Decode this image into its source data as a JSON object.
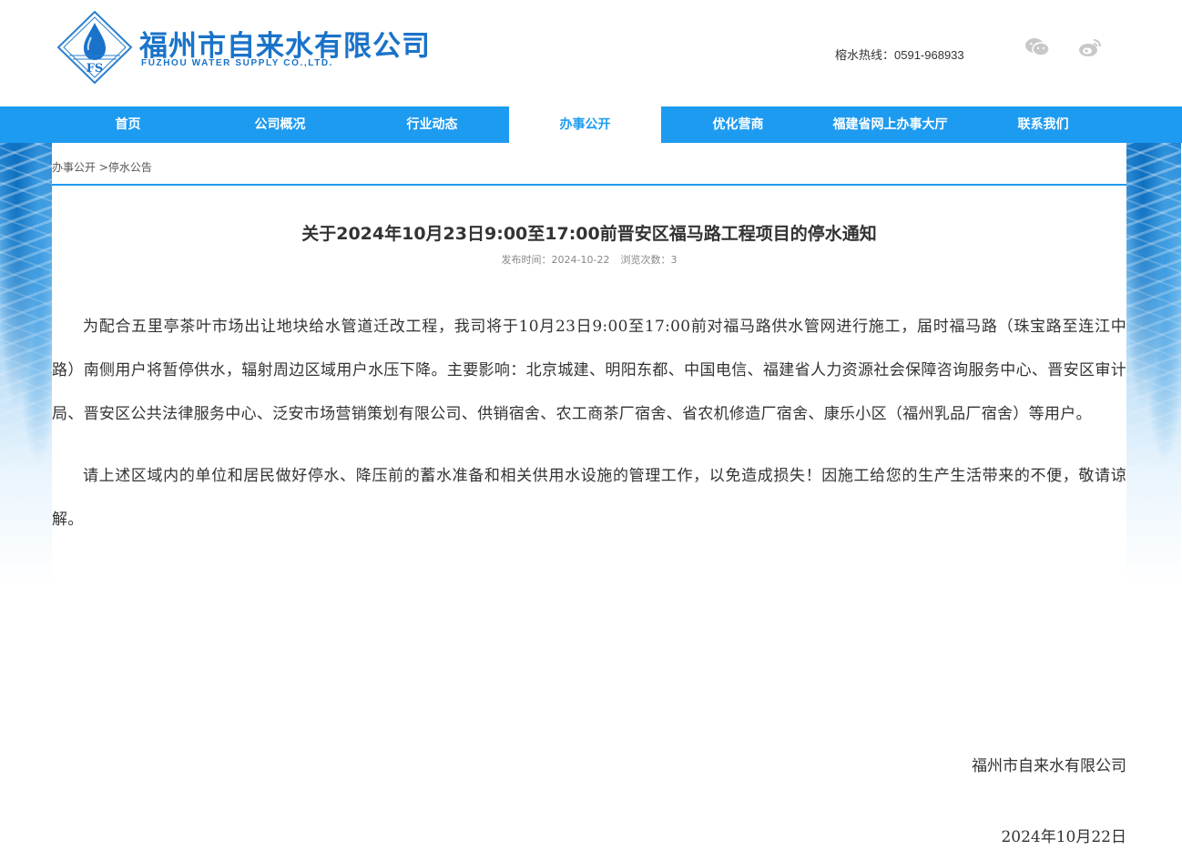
{
  "header": {
    "brand_cn": "福州市自来水有限公司",
    "brand_en": "FUZHOU WATER SUPPLY CO.,LTD.",
    "logo_text": "FS",
    "hotline_label": "榕水热线：",
    "hotline_number": "0591-968933",
    "social": [
      "wechat-icon",
      "weibo-icon"
    ]
  },
  "nav": {
    "items": [
      {
        "label": "首页"
      },
      {
        "label": "公司概况"
      },
      {
        "label": "行业动态"
      },
      {
        "label": "办事公开"
      },
      {
        "label": "优化营商"
      },
      {
        "label": "福建省网上办事大厅"
      },
      {
        "label": "联系我们"
      }
    ],
    "active": "办事公开"
  },
  "breadcrumb": {
    "parent": "办事公开",
    "separator": " >",
    "current": "停水公告"
  },
  "article": {
    "title": "关于2024年10月23日9:00至17:00前晋安区福马路工程项目的停水通知",
    "publish_label": "发布时间：2024-10-22",
    "views_label": "浏览次数：3",
    "paragraphs": [
      "为配合五里亭茶叶市场出让地块给水管道迁改工程，我司将于10月23日9:00至17:00前对福马路供水管网进行施工，届时福马路（珠宝路至连江中路）南侧用户将暂停供水，辐射周边区域用户水压下降。主要影响：北京城建、明阳东都、中国电信、福建省人力资源社会保障咨询服务中心、晋安区审计局、晋安区公共法律服务中心、泛安市场营销策划有限公司、供销宿舍、农工商茶厂宿舍、省农机修造厂宿舍、康乐小区（福州乳品厂宿舍）等用户。",
      "请上述区域内的单位和居民做好停水、降压前的蓄水准备和相关供用水设施的管理工作，以免造成损失！因施工给您的生产生活带来的不便，敬请谅解。"
    ],
    "signature": "福州市自来水有限公司",
    "date": "2024年10月22日"
  },
  "colors": {
    "brand_blue": "#1a73c9",
    "nav_blue": "#1d9bf0",
    "text": "#333333"
  }
}
